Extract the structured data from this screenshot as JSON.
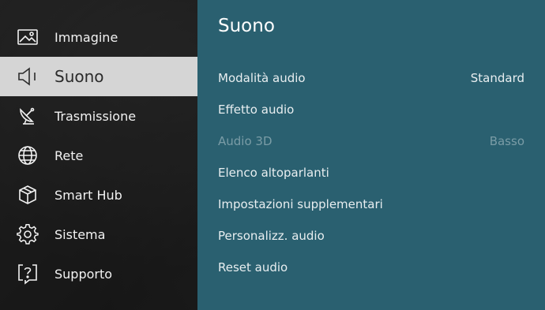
{
  "sidebar": {
    "items": [
      {
        "label": "Immagine",
        "icon": "image-icon"
      },
      {
        "label": "Suono",
        "icon": "speaker-icon",
        "selected": true
      },
      {
        "label": "Trasmissione",
        "icon": "satellite-dish-icon"
      },
      {
        "label": "Rete",
        "icon": "globe-icon"
      },
      {
        "label": "Smart Hub",
        "icon": "cube-icon"
      },
      {
        "label": "Sistema",
        "icon": "gear-icon"
      },
      {
        "label": "Supporto",
        "icon": "help-icon"
      }
    ]
  },
  "panel": {
    "title": "Suono",
    "rows": [
      {
        "label": "Modalità audio",
        "value": "Standard"
      },
      {
        "label": "Effetto audio"
      },
      {
        "label": "Audio 3D",
        "value": "Basso",
        "disabled": true
      },
      {
        "label": "Elenco altoparlanti"
      },
      {
        "label": "Impostazioni supplementari"
      },
      {
        "label": "Personalizz. audio"
      },
      {
        "label": "Reset audio"
      }
    ]
  },
  "colors": {
    "panel_bg": "#2a6070",
    "selected_bg": "#d5d5d5",
    "disabled_text": "#7a9ca6"
  }
}
